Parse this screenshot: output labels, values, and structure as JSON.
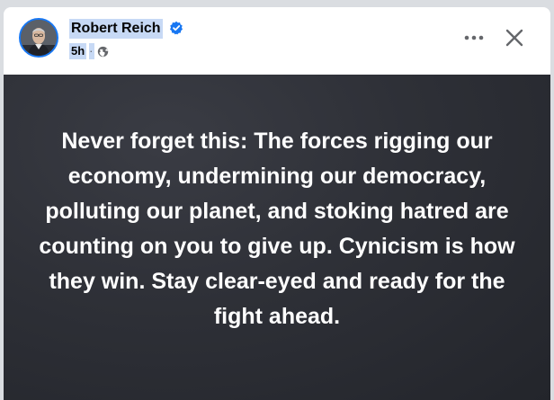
{
  "post": {
    "author_name": "Robert Reich",
    "time": "5h",
    "separator": "·",
    "verified": true,
    "audience_icon": "globe-icon",
    "more_icon": "more-options-icon",
    "close_icon": "close-icon"
  },
  "media": {
    "quote": "Never forget this: The forces rigging our economy, undermining our democracy, polluting our planet, and stoking hatred are counting on you to give up. Cynicism is how they win. Stay clear-eyed and ready for the fight ahead.",
    "text_color": "#ffffff",
    "background": "#2e3037"
  },
  "colors": {
    "verified_badge": "#1877f2",
    "selection_highlight": "#c7d9f5"
  }
}
